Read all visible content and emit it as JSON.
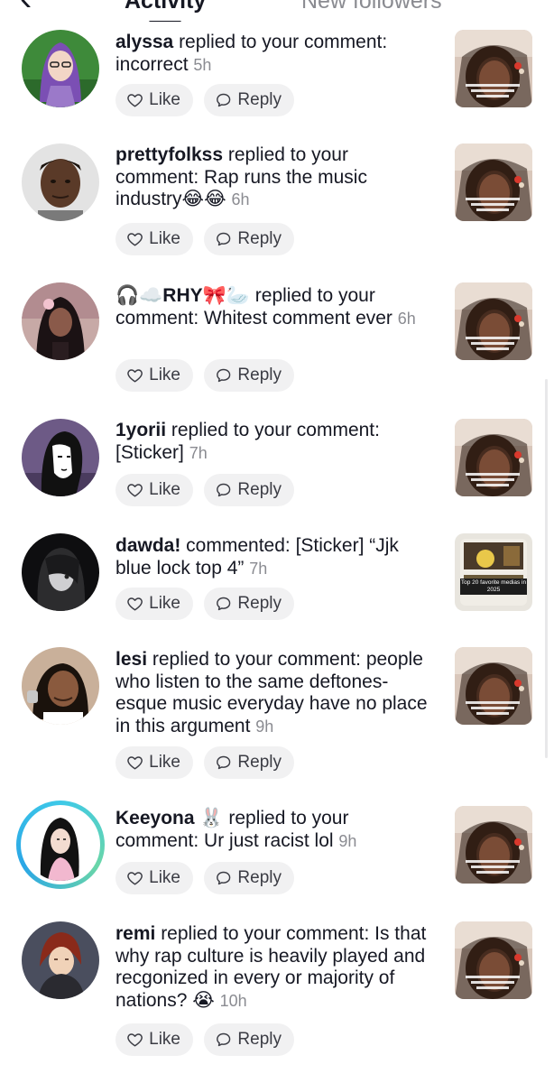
{
  "header": {
    "tab_activity": "Activity",
    "tab_followers": "New followers"
  },
  "actions": {
    "like_label": "Like",
    "reply_label": "Reply"
  },
  "items": [
    {
      "user": "alyssa",
      "pre": " replied to your comment: ",
      "body": "incorrect",
      "time": "5h"
    },
    {
      "user": "prettyfolkss",
      "pre": " replied to your comment: ",
      "body": "Rap runs the music industry😂😂",
      "time": "6h"
    },
    {
      "user": "🎧☁️RHY🎀🦢",
      "pre": " replied to your comment: ",
      "body": "Whitest comment ever",
      "time": "6h"
    },
    {
      "user": "1yorii",
      "pre": " replied to your comment: ",
      "body": "[Sticker]",
      "time": "7h"
    },
    {
      "user": "dawda!",
      "pre": " commented: ",
      "body": "[Sticker] “Jjk blue lock top 4”",
      "time": "7h"
    },
    {
      "user": "lesi",
      "pre": " replied to your comment: ",
      "body": "people who listen to the same deftones-esque music everyday have no place in this argument",
      "time": "9h"
    },
    {
      "user": "Keeyona 🐰",
      "pre": " replied to your comment: ",
      "body": "Ur just racist lol",
      "time": "9h"
    },
    {
      "user": "remi",
      "pre": " replied to your comment: ",
      "body": "Is that why rap culture is heavily played and recgonized in every or majority of nations? 😭",
      "time": "10h"
    }
  ],
  "thumb_caption": "Top 20 favorite medias in 2025",
  "colors": {
    "pill_bg": "#f1f1f2",
    "time_gray": "#8a8b91",
    "ring_teal": "#3ec9e8"
  }
}
